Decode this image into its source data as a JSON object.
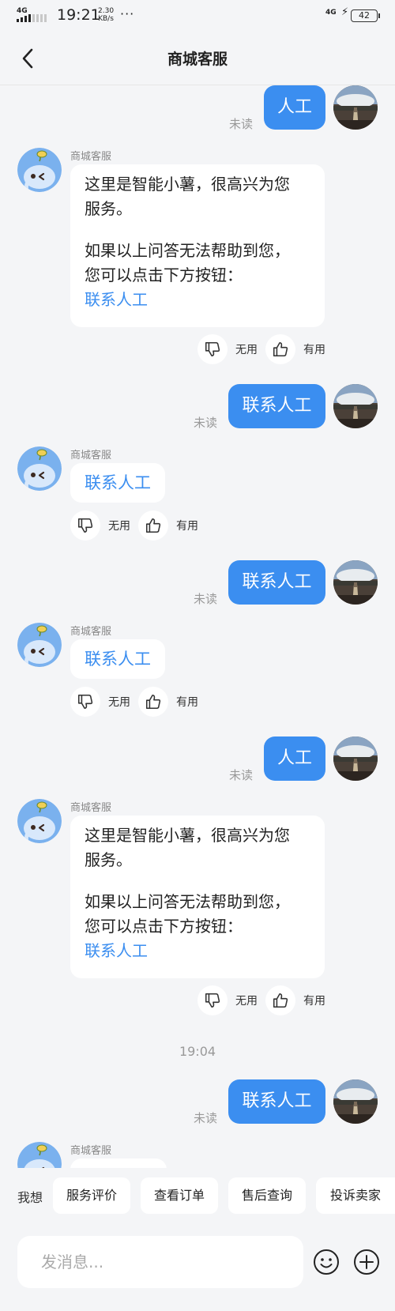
{
  "status_bar": {
    "network_left": "4G",
    "time": "19:21",
    "speed_value": "2.30",
    "speed_unit": "KB/s",
    "more": "···",
    "network_right": "4G",
    "battery": "42"
  },
  "header": {
    "title": "商城客服"
  },
  "chat": {
    "bot_name": "商城客服",
    "unread_label": "未读",
    "transfer_short": "人工",
    "transfer_long": "联系人工",
    "bot_intro_line1": "这里是智能小薯，很高兴为您",
    "bot_intro_line2": "服务。",
    "bot_intro_line3": "如果以上问答无法帮助到您，",
    "bot_intro_line4": "您可以点击下方按钮：",
    "contact_link": "联系人工",
    "feedback_useless": "无用",
    "feedback_useful": "有用",
    "timestamp": "19:04"
  },
  "quick_bar": {
    "label": "我想",
    "chips": [
      "服务评价",
      "查看订单",
      "售后查询",
      "投诉卖家"
    ]
  },
  "input": {
    "placeholder": "发消息..."
  },
  "colors": {
    "accent": "#3b8ef0",
    "background": "#f4f5f7"
  },
  "icons": [
    "back-icon",
    "thumb-down-icon",
    "thumb-up-icon",
    "emoji-icon",
    "plus-icon",
    "bot-avatar",
    "user-avatar"
  ]
}
